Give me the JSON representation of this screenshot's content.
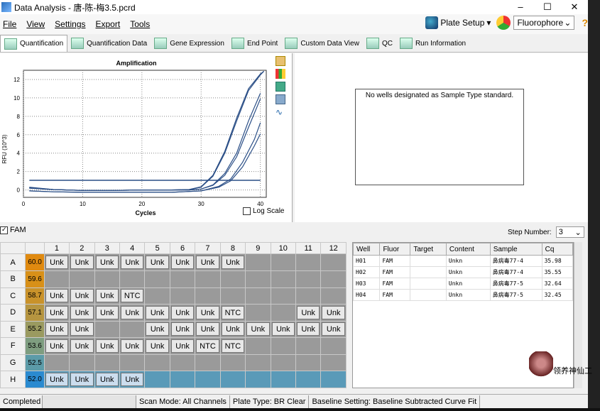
{
  "window": {
    "title": "Data Analysis - 唐-陈-梅3.5.pcrd",
    "min": "–",
    "max": "☐",
    "close": "✕"
  },
  "menu": {
    "file": "File",
    "view": "View",
    "settings": "Settings",
    "export": "Export",
    "tools": "Tools",
    "plate_setup": "Plate Setup",
    "fluorophore": "Fluorophore",
    "help": "?"
  },
  "tabs": [
    "Quantification",
    "Quantification Data",
    "Gene Expression",
    "End Point",
    "Custom Data View",
    "QC",
    "Run Information"
  ],
  "std_message": "No wells designated as Sample Type standard.",
  "log_scale_label": "Log Scale",
  "fam_label": "FAM",
  "step_label": "Step Number:",
  "step_value": "3",
  "plate": {
    "columns": [
      "1",
      "2",
      "3",
      "4",
      "5",
      "6",
      "7",
      "8",
      "9",
      "10",
      "11",
      "12"
    ],
    "rows": [
      {
        "label": "A",
        "temp": "60.0",
        "color": "#e08a10",
        "wells": [
          "Unk",
          "Unk",
          "Unk",
          "Unk",
          "Unk",
          "Unk",
          "Unk",
          "Unk",
          "",
          "",
          "",
          ""
        ]
      },
      {
        "label": "B",
        "temp": "59.6",
        "color": "#d89018",
        "wells": [
          "",
          "",
          "",
          "",
          "",
          "",
          "",
          "",
          "",
          "",
          "",
          ""
        ]
      },
      {
        "label": "C",
        "temp": "58.7",
        "color": "#c9922a",
        "wells": [
          "Unk",
          "Unk",
          "Unk",
          "NTC",
          "",
          "",
          "",
          "",
          "",
          "",
          "",
          ""
        ]
      },
      {
        "label": "D",
        "temp": "57.1",
        "color": "#b69540",
        "wells": [
          "Unk",
          "Unk",
          "Unk",
          "Unk",
          "Unk",
          "Unk",
          "Unk",
          "NTC",
          "",
          "",
          "Unk",
          "Unk"
        ]
      },
      {
        "label": "E",
        "temp": "55.2",
        "color": "#9a9a60",
        "wells": [
          "Unk",
          "Unk",
          "",
          "",
          "Unk",
          "Unk",
          "Unk",
          "Unk",
          "Unk",
          "Unk",
          "Unk",
          "Unk"
        ]
      },
      {
        "label": "F",
        "temp": "53.6",
        "color": "#7e9d80",
        "wells": [
          "Unk",
          "Unk",
          "Unk",
          "Unk",
          "Unk",
          "Unk",
          "NTC",
          "NTC",
          "",
          "",
          "",
          ""
        ]
      },
      {
        "label": "G",
        "temp": "52.5",
        "color": "#5c9ba8",
        "wells": [
          "",
          "",
          "",
          "",
          "",
          "",
          "",
          "",
          "",
          "",
          "",
          ""
        ]
      },
      {
        "label": "H",
        "temp": "52.0",
        "color": "#2a8ad0",
        "wells": [
          "Unk",
          "Unk",
          "Unk",
          "Unk",
          "",
          "",
          "",
          "",
          "",
          "",
          "",
          ""
        ],
        "selected": true
      }
    ]
  },
  "results": {
    "headers": [
      "Well",
      "Fluor",
      "Target",
      "Content",
      "Sample",
      "Cq"
    ],
    "rows": [
      {
        "well": "H01",
        "fluor": "FAM",
        "target": "",
        "content": "Unkn",
        "sample": "鼻病毒77-4",
        "cq": "35.98"
      },
      {
        "well": "H02",
        "fluor": "FAM",
        "target": "",
        "content": "Unkn",
        "sample": "鼻病毒77-4",
        "cq": "35.55"
      },
      {
        "well": "H03",
        "fluor": "FAM",
        "target": "",
        "content": "Unkn",
        "sample": "鼻病毒77-5",
        "cq": "32.64"
      },
      {
        "well": "H04",
        "fluor": "FAM",
        "target": "",
        "content": "Unkn",
        "sample": "鼻病毒77-5",
        "cq": "32.45"
      }
    ]
  },
  "status": {
    "state": "Completed",
    "scan_mode": "Scan Mode: All Channels",
    "plate_type": "Plate Type: BR Clear",
    "baseline": "Baseline Setting: Baseline Subtracted Curve Fit"
  },
  "overlay": {
    "avatar_text": "领养神仙工"
  },
  "chart_data": {
    "type": "line",
    "title": "Amplification",
    "xlabel": "Cycles",
    "ylabel": "RFU (10^3)",
    "xlim": [
      0,
      41
    ],
    "ylim": [
      -0.8,
      13
    ],
    "xticks": [
      0,
      10,
      20,
      30,
      40
    ],
    "yticks": [
      0,
      2,
      4,
      6,
      8,
      10,
      12
    ],
    "grid": true,
    "threshold": 1.05,
    "series_color": "#2a4e86",
    "series": [
      {
        "x": [
          1,
          5,
          10,
          15,
          20,
          25,
          28,
          30,
          32,
          34,
          36,
          38,
          40
        ],
        "y": [
          0.3,
          0.05,
          -0.05,
          -0.05,
          0,
          0,
          0,
          0.1,
          0.5,
          1.6,
          3.6,
          6.8,
          9.9
        ]
      },
      {
        "x": [
          1,
          5,
          10,
          15,
          20,
          25,
          28,
          30,
          32,
          34,
          36,
          38,
          40
        ],
        "y": [
          0.25,
          0.05,
          -0.05,
          -0.05,
          0,
          0,
          0,
          0.1,
          0.55,
          1.8,
          4.0,
          7.5,
          10.5
        ]
      },
      {
        "x": [
          1,
          5,
          10,
          15,
          20,
          25,
          28,
          30,
          32,
          34,
          36,
          38,
          40,
          40.6
        ],
        "y": [
          0.2,
          0.05,
          -0.05,
          -0.05,
          0,
          0,
          0.05,
          0.3,
          1.5,
          4.0,
          7.5,
          10.8,
          12.5,
          12.9
        ]
      },
      {
        "x": [
          1,
          5,
          10,
          15,
          20,
          25,
          28,
          30,
          32,
          34,
          36,
          38,
          40,
          40.6
        ],
        "y": [
          0.2,
          0.05,
          -0.05,
          -0.05,
          0,
          0,
          0.05,
          0.35,
          1.6,
          4.2,
          7.8,
          11.0,
          12.6,
          12.9
        ]
      },
      {
        "x": [
          1,
          5,
          10,
          15,
          20,
          25,
          30,
          33,
          35,
          37,
          39,
          40
        ],
        "y": [
          -0.1,
          -0.2,
          -0.25,
          -0.25,
          -0.25,
          -0.25,
          -0.1,
          0.3,
          1.0,
          2.5,
          4.8,
          6.1
        ]
      },
      {
        "x": [
          1,
          5,
          10,
          15,
          20,
          25,
          30,
          33,
          35,
          37,
          39,
          40
        ],
        "y": [
          -0.1,
          -0.2,
          -0.25,
          -0.25,
          -0.25,
          -0.25,
          -0.1,
          0.4,
          1.2,
          3.0,
          5.5,
          7.3
        ]
      }
    ]
  }
}
